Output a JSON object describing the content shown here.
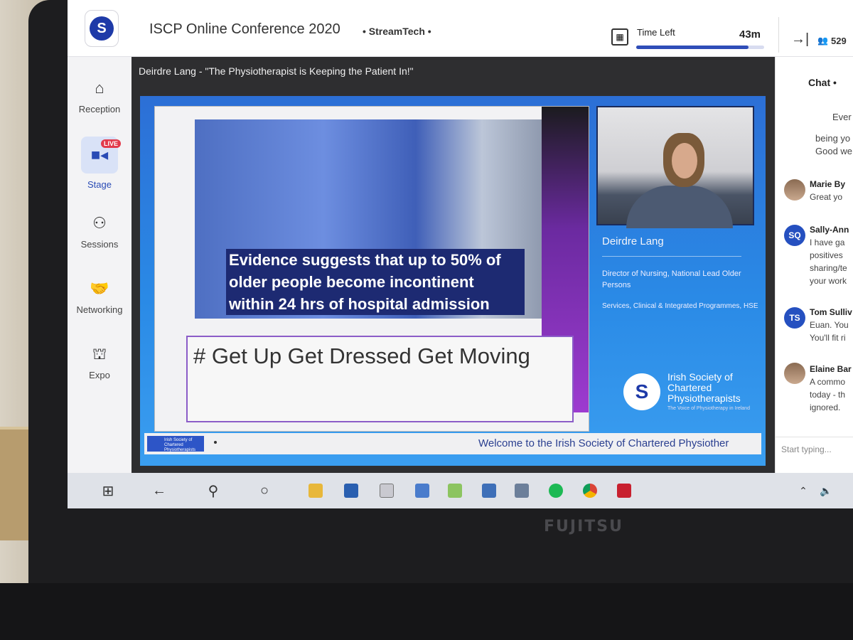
{
  "header": {
    "logo_letter": "S",
    "event_title": "ISCP Online Conference 2020",
    "organizer": "• StreamTech •",
    "time_left_label": "Time Left",
    "time_left_value": "43m",
    "time_left_progress_pct": 88,
    "attendee_count": "529"
  },
  "sidebar": {
    "items": [
      {
        "label": "Reception",
        "icon": "home-icon"
      },
      {
        "label": "Stage",
        "icon": "camera-icon",
        "badge": "LIVE"
      },
      {
        "label": "Sessions",
        "icon": "group-table-icon"
      },
      {
        "label": "Networking",
        "icon": "handshake-icon"
      },
      {
        "label": "Expo",
        "icon": "booth-icon"
      }
    ]
  },
  "stage": {
    "session_title": "Deirdre Lang - \"The Physiotherapist is Keeping the Patient In!\"",
    "slide": {
      "evidence_text": "Evidence suggests that up to 50% of older people become incontinent within 24 hrs of hospital admission",
      "hashtag_text": "# Get Up Get Dressed Get Moving"
    },
    "speaker": {
      "name": "Deirdre Lang",
      "role": "Director of Nursing, National Lead Older Persons",
      "org": "Services, Clinical & Integrated Programmes, HSE"
    },
    "society_logo": {
      "letter": "S",
      "name": "Irish Society of Chartered Physiotherapists",
      "tagline": "The Voice of Physiotherapy in Ireland"
    },
    "ticker_text": "Welcome to the Irish Society of Chartered Physiother"
  },
  "chat": {
    "title": "Chat •",
    "fragments": [
      "Ever",
      "being yo",
      "Good we"
    ],
    "messages": [
      {
        "initials": "",
        "name": "Marie By",
        "text": "Great yo"
      },
      {
        "initials": "SQ",
        "name": "Sally-Ann",
        "text": "I have ga\npositives\nsharing/te\nyour work"
      },
      {
        "initials": "TS",
        "name": "Tom Sulliv",
        "text": "Euan. You\nYou'll fit ri"
      },
      {
        "initials": "",
        "name": "Elaine Bar",
        "text": "A commo\ntoday - th\nignored."
      }
    ],
    "input_placeholder": "Start typing..."
  },
  "device": {
    "brand": "FUJITSU"
  },
  "taskbar": {
    "icons": [
      "windows-start-icon",
      "back-arrow-icon",
      "search-icon",
      "cortana-icon",
      "file-explorer-icon",
      "powershell-icon",
      "chart-app-icon",
      "remote-desktop-icon",
      "notes-app-icon",
      "network-app-icon",
      "printer-app-icon",
      "spotify-icon",
      "chrome-icon",
      "mcafee-icon"
    ],
    "tray": [
      "chevron-up-icon",
      "volume-icon"
    ],
    "accent": "#2f4db8"
  }
}
